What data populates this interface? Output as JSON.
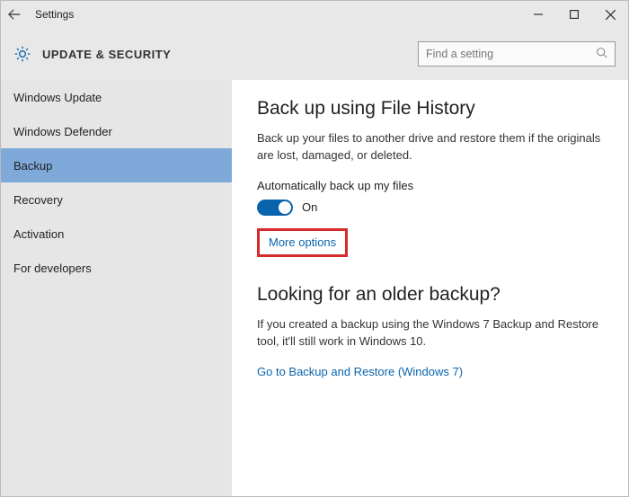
{
  "titlebar": {
    "title": "Settings"
  },
  "header": {
    "title": "UPDATE & SECURITY",
    "search_placeholder": "Find a setting"
  },
  "sidebar": {
    "items": [
      {
        "label": "Windows Update"
      },
      {
        "label": "Windows Defender"
      },
      {
        "label": "Backup"
      },
      {
        "label": "Recovery"
      },
      {
        "label": "Activation"
      },
      {
        "label": "For developers"
      }
    ]
  },
  "content": {
    "section1": {
      "heading": "Back up using File History",
      "description": "Back up your files to another drive and restore them if the originals are lost, damaged, or deleted.",
      "toggle_label": "Automatically back up my files",
      "toggle_state": "On",
      "more_options": "More options"
    },
    "section2": {
      "heading": "Looking for an older backup?",
      "description": "If you created a backup using the Windows 7 Backup and Restore tool, it'll still work in Windows 10.",
      "link": "Go to Backup and Restore (Windows 7)"
    }
  }
}
